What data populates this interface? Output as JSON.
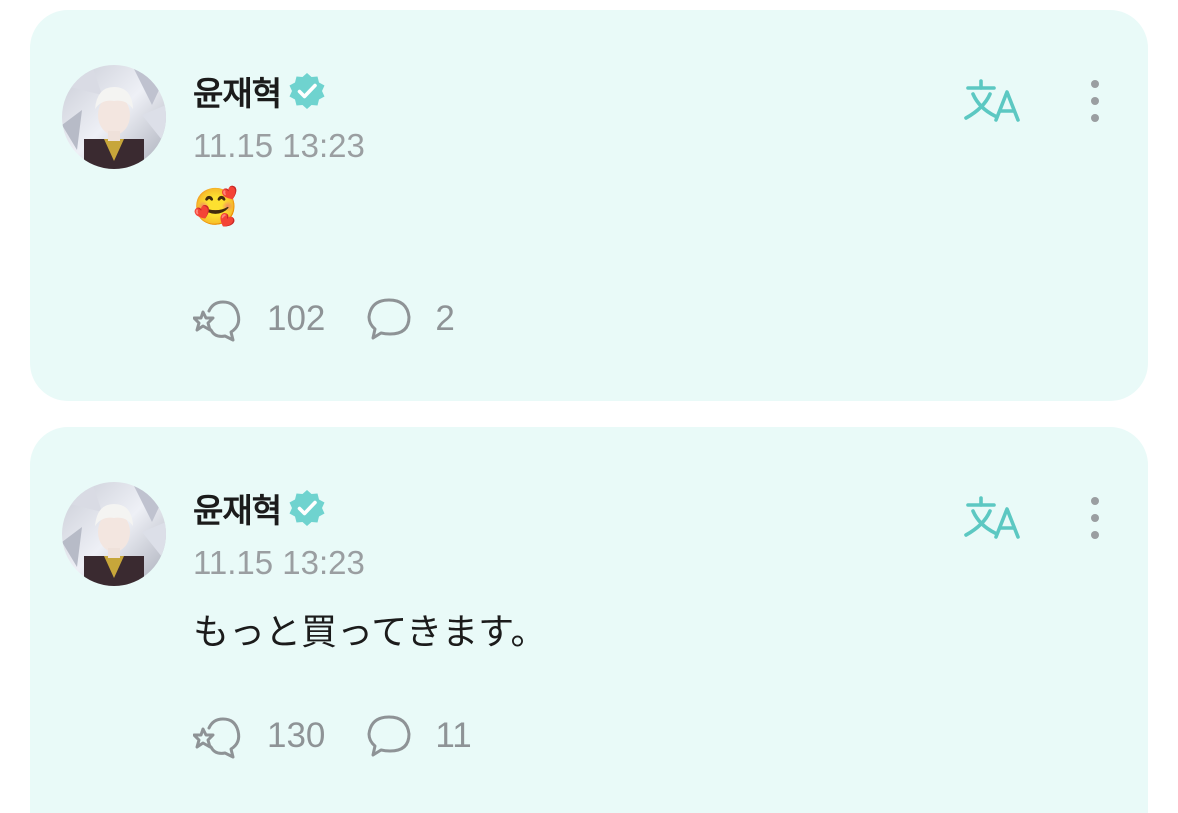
{
  "posts": [
    {
      "author": "윤재혁",
      "time": "11.15 13:23",
      "text": "🥰",
      "likes": "102",
      "comments": "2"
    },
    {
      "author": "윤재혁",
      "time": "11.15 13:23",
      "text": "もっと買ってきます。",
      "likes": "130",
      "comments": "11"
    }
  ],
  "icons": {
    "verified": "verified-badge-icon",
    "translate": "translate-icon",
    "more": "more-vertical-icon",
    "like": "sparkle-heart-icon",
    "comment": "comment-bubble-icon"
  },
  "colors": {
    "card_background": "#e9faf8",
    "accent": "#5cc8c2",
    "verified": "#6fd3cf",
    "muted": "#8e9396"
  }
}
